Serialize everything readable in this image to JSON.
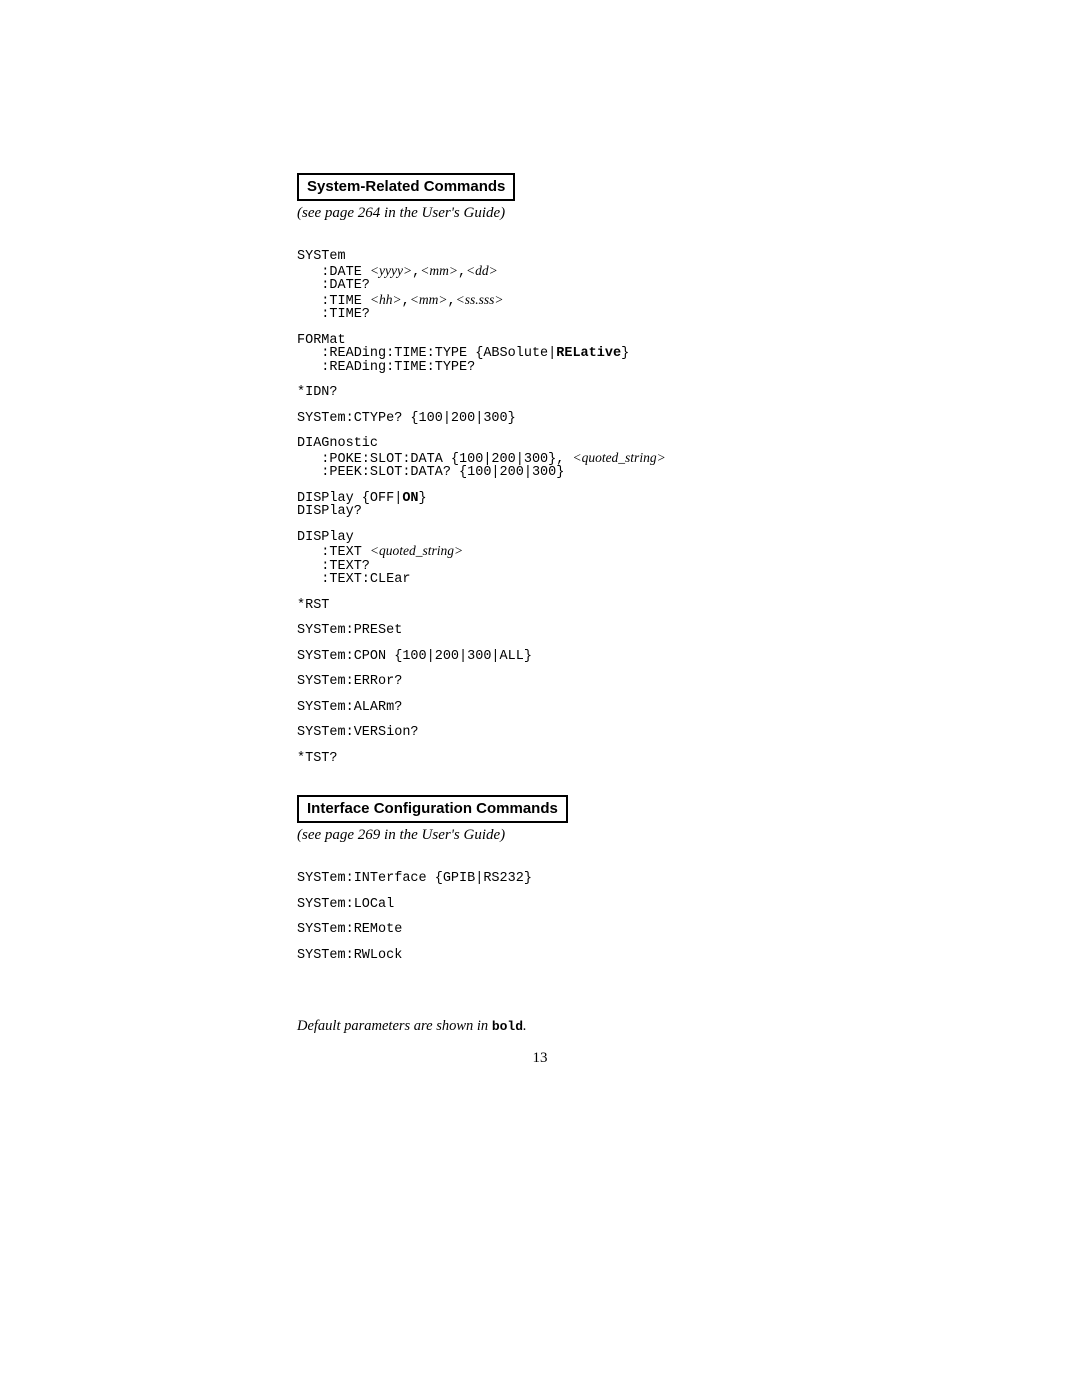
{
  "headings": {
    "system": "System-Related Commands",
    "interface": "Interface Configuration Commands"
  },
  "subheads": {
    "system": "(see page 264 in the User's Guide)",
    "interface": "(see page 269 in the User's Guide)"
  },
  "code": {
    "system_block1_l1": "SYSTem",
    "system_block1_l2a": "   :DATE ",
    "system_block1_l2b": "<yyyy>",
    "system_block1_l2c": ",",
    "system_block1_l2d": "<mm>",
    "system_block1_l2e": ",",
    "system_block1_l2f": "<dd>",
    "system_block1_l3": "   :DATE?",
    "system_block1_l4a": "   :TIME ",
    "system_block1_l4b": "<hh>",
    "system_block1_l4c": ",",
    "system_block1_l4d": "<mm>",
    "system_block1_l4e": ",",
    "system_block1_l4f": "<ss.sss>",
    "system_block1_l5": "   :TIME?",
    "format_l1": "FORMat",
    "format_l2a": "   :READing:TIME:TYPE {ABSolute|",
    "format_l2b": "RELative",
    "format_l2c": "}",
    "format_l3": "   :READing:TIME:TYPE?",
    "idn": "*IDN?",
    "ctype": "SYSTem:CTYPe? {100|200|300}",
    "diag_l1": "DIAGnostic",
    "diag_l2a": "   :POKE:SLOT:DATA {100|200|300}, ",
    "diag_l2b": "<quoted_string>",
    "diag_l3": "   :PEEK:SLOT:DATA? {100|200|300}",
    "display1_l1a": "DISPlay {OFF|",
    "display1_l1b": "ON",
    "display1_l1c": "}",
    "display1_l2": "DISPlay?",
    "display2_l1": "DISPlay",
    "display2_l2a": "   :TEXT ",
    "display2_l2b": "<quoted_string>",
    "display2_l3": "   :TEXT?",
    "display2_l4": "   :TEXT:CLEar",
    "rst": "*RST",
    "preset": "SYSTem:PRESet",
    "cpon": "SYSTem:CPON {100|200|300|ALL}",
    "error": "SYSTem:ERRor?",
    "alarm": "SYSTem:ALARm?",
    "version": "SYSTem:VERSion?",
    "tst": "*TST?",
    "iface_l1": "SYSTem:INTerface {GPIB|RS232}",
    "iface_l2": "SYSTem:LOCal",
    "iface_l3": "SYSTem:REMote",
    "iface_l4": "SYSTem:RWLock"
  },
  "footnote": {
    "prefix": "Default parameters are shown in ",
    "bold": "bold",
    "suffix": "."
  },
  "page_number": "13"
}
